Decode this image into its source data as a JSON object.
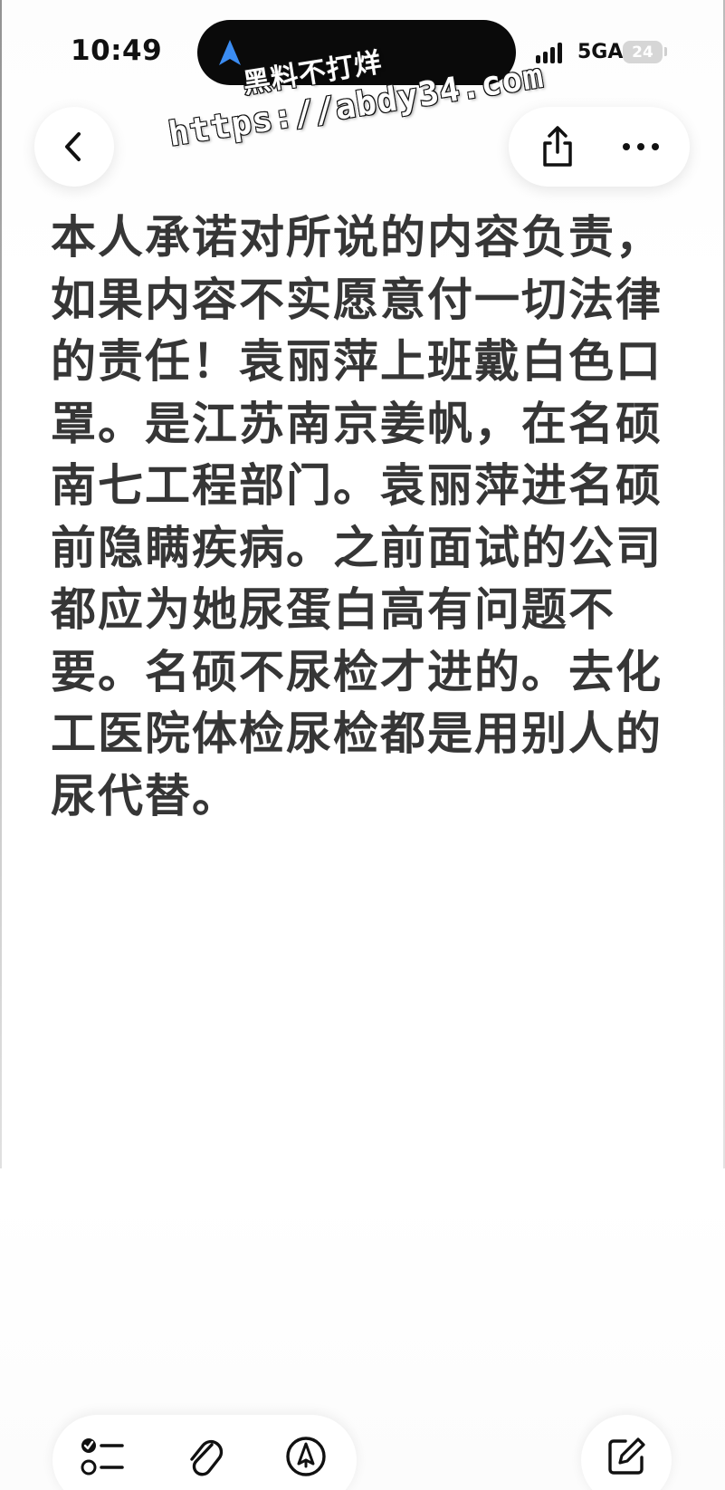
{
  "status_bar": {
    "time": "10:49",
    "network": "5GA",
    "battery": "24",
    "icons": [
      "location-arrow-icon",
      "signal-icon",
      "battery-icon"
    ]
  },
  "watermark": {
    "line1": "黑料不打烊",
    "line2": "https://abdy34.com"
  },
  "navigation": {
    "icons": [
      "chevron-left-icon",
      "share-icon",
      "more-icon"
    ]
  },
  "note": {
    "body": "本人承诺对所说的内容负责，如果内容不实愿意付一切法律的责任！袁丽萍上班戴白色口罩。是江苏南京姜帆，在名硕南七工程部门。袁丽萍进名硕前隐瞒疾病。之前面试的公司都应为她尿蛋白高有问题不要。名硕不尿检才进的。去化工医院体检尿检都是用别人的尿代替。"
  },
  "toolbar": {
    "icons": [
      "checklist-icon",
      "paperclip-icon",
      "markup-icon",
      "compose-icon"
    ]
  },
  "colors": {
    "accent": "#3b8cf2",
    "text": "#363636",
    "background": "#ffffff"
  }
}
